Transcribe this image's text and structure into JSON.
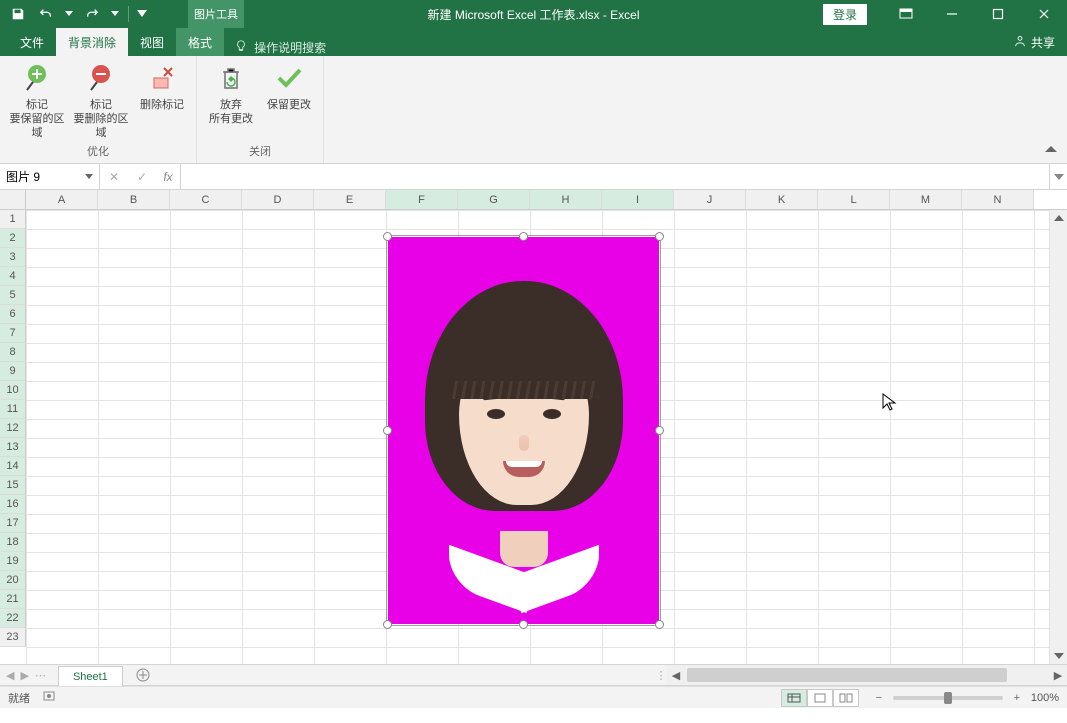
{
  "title": "新建 Microsoft Excel 工作表.xlsx - Excel",
  "context_tool_label": "图片工具",
  "login_label": "登录",
  "tabs": {
    "file": "文件",
    "bgremove": "背景消除",
    "view": "视图",
    "format": "格式"
  },
  "tell_me": "操作说明搜索",
  "share": "共享",
  "ribbon": {
    "group_optimize": "优化",
    "group_close": "关闭",
    "mark_keep": {
      "l1": "标记",
      "l2": "要保留的区域"
    },
    "mark_remove": {
      "l1": "标记",
      "l2": "要删除的区域"
    },
    "mark_delete": "删除标记",
    "discard": {
      "l1": "放弃",
      "l2": "所有更改"
    },
    "keep": "保留更改"
  },
  "name_box_value": "图片 9",
  "formula_value": "",
  "columns": [
    "A",
    "B",
    "C",
    "D",
    "E",
    "F",
    "G",
    "H",
    "I",
    "J",
    "K",
    "L",
    "M",
    "N"
  ],
  "highlighted_cols": [
    "F",
    "G",
    "H",
    "I"
  ],
  "rows_count": 23,
  "highlighted_row_start": 2,
  "highlighted_row_end": 22,
  "image_bg_color": "#e800e6",
  "sheet_tab": "Sheet1",
  "status_ready": "就绪",
  "zoom": "100%"
}
